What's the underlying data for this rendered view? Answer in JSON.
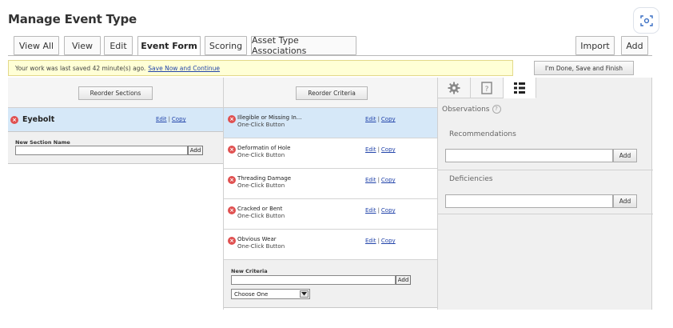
{
  "page": {
    "title": "Manage Event Type"
  },
  "tabs": [
    {
      "label": "View All"
    },
    {
      "label": "View"
    },
    {
      "label": "Edit"
    },
    {
      "label": "Event Form",
      "active": true
    },
    {
      "label": "Scoring"
    },
    {
      "label": "Asset Type Associations"
    }
  ],
  "actions": {
    "import_label": "Import",
    "add_label": "Add",
    "done_label": "I'm Done, Save and Finish"
  },
  "notice": {
    "text": "Your work was last saved 42 minute(s) ago.",
    "link": "Save Now and Continue"
  },
  "sections_panel": {
    "reorder_label": "Reorder Sections",
    "sections": [
      {
        "name": "Eyebolt",
        "edit": "Edit",
        "copy": "Copy",
        "separator": "|"
      }
    ],
    "new_section_label": "New Section Name",
    "add_label": "Add"
  },
  "criteria_panel": {
    "reorder_label": "Reorder Criteria",
    "criteria": [
      {
        "name": "Illegible or Missing In...",
        "type": "One-Click Button",
        "edit": "Edit",
        "copy": "Copy",
        "separator": "|"
      },
      {
        "name": "Deformatin of Hole",
        "type": "One-Click Button",
        "edit": "Edit",
        "copy": "Copy",
        "separator": "|"
      },
      {
        "name": "Threading Damage",
        "type": "One-Click Button",
        "edit": "Edit",
        "copy": "Copy",
        "separator": "|"
      },
      {
        "name": "Cracked or Bent",
        "type": "One-Click Button",
        "edit": "Edit",
        "copy": "Copy",
        "separator": "|"
      },
      {
        "name": "Obvious Wear",
        "type": "One-Click Button",
        "edit": "Edit",
        "copy": "Copy",
        "separator": "|"
      }
    ],
    "new_criteria_label": "New Criteria",
    "add_label": "Add",
    "type_select_value": "Choose One"
  },
  "observations_panel": {
    "icons": [
      "gear-icon",
      "help-page-icon",
      "list-icon"
    ],
    "title": "Observations",
    "help_glyph": "?",
    "recommendations_label": "Recommendations",
    "deficiencies_label": "Deficiencies",
    "add_label": "Add"
  },
  "colors": {
    "selected_row": "#d6e8f8",
    "notice_bg": "#ffffd6",
    "delete": "#e05050",
    "link": "#2244aa"
  }
}
